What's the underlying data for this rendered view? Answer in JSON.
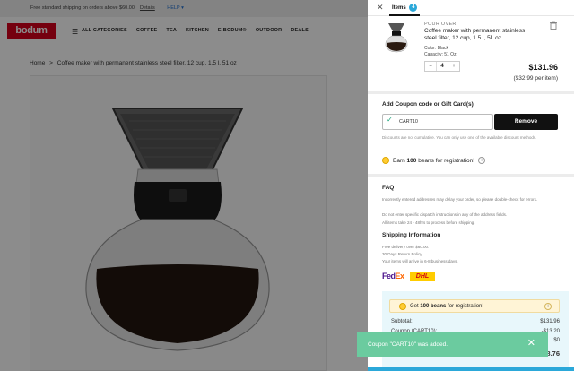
{
  "topbar": {
    "shipping_text": "Free standard shipping on orders above $60.00.",
    "details_link": "Details",
    "help_label": "HELP ▾"
  },
  "nav": {
    "logo": "bodum",
    "menu_icon": "hamburger-icon",
    "items": [
      "ALL CATEGORIES",
      "COFFEE",
      "TEA",
      "KITCHEN",
      "E-BODUM®",
      "OUTDOOR",
      "DEALS"
    ]
  },
  "breadcrumb": {
    "home": "Home",
    "separator": ">",
    "current": "Coffee maker with permanent stainless steel filter, 12 cup, 1.5 l, 51 oz"
  },
  "cart": {
    "close_icon": "close-icon",
    "tab_label": "Items",
    "tab_count": "4",
    "item": {
      "category": "POUR OVER",
      "title": "Coffee maker with permanent stainless steel filter, 12 cup, 1.5 l, 51 oz",
      "color": "Color: Black",
      "capacity": "Capacity: 51 Oz",
      "qty_minus": "−",
      "qty_value": "4",
      "qty_plus": "+",
      "price": "$131.96",
      "unit_price": "($32.99 per item)"
    },
    "coupon": {
      "title": "Add Coupon code or Gift Card(s)",
      "code": "CART10",
      "remove_label": "Remove",
      "note": "Discounts are not cumulative. You can only use one of the available discount methods."
    },
    "beans": {
      "prefix": "Earn ",
      "amount": "100",
      "suffix": " beans for registration!"
    },
    "faq": {
      "title": "FAQ",
      "line1": "Incorrectly entered addresses may delay your order, so please double-check for errors.",
      "line2": "Do not enter specific dispatch instructions in any of the address fields.",
      "line3": "All items take 24 - 48hrs to process before shipping."
    },
    "shipping": {
      "title": "Shipping Information",
      "lines": [
        "Free delivery over $60.00.",
        "30 Days Return Policy.",
        "Your items will arrive in 6-8 business days."
      ]
    },
    "carriers": {
      "fedex_fe": "Fed",
      "fedex_ex": "Ex",
      "dhl": "DHL"
    },
    "summary": {
      "beans_prefix": "Get ",
      "beans_amount": "100 beans",
      "beans_suffix": " for registration!",
      "subtotal_label": "Subtotal:",
      "subtotal_value": "$131.96",
      "coupon_label": "Coupon (CART10):",
      "coupon_value": "-$13.20",
      "shipping_value": "$0",
      "total_value": "$118.76"
    }
  },
  "toast": {
    "message": "Coupon \"CART10\" was added.",
    "close_icon": "close-icon"
  },
  "colors": {
    "brand_red": "#d6001c",
    "accent_blue": "#2ba8d9",
    "toast_green": "#6bcb9f"
  }
}
